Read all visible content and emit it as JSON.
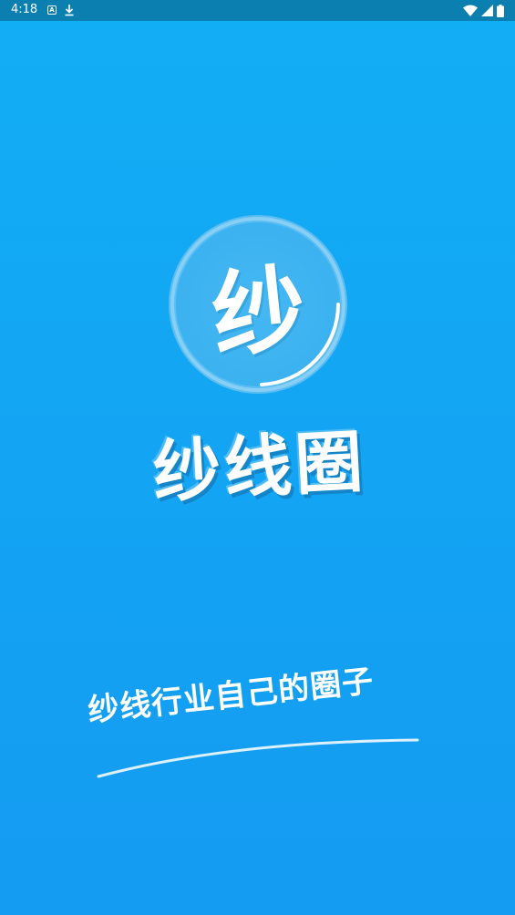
{
  "status_bar": {
    "time": "4:18",
    "icons": [
      "a-notification-icon",
      "download-icon",
      "wifi-icon",
      "signal-icon",
      "battery-icon"
    ]
  },
  "logo": {
    "char": "纱"
  },
  "app_name": "纱线圈",
  "slogan": "纱线行业自己的圈子",
  "colors": {
    "background_top": "#12AEF4",
    "background_bottom": "#149BF2",
    "status_bar": "#0A7FB0",
    "text": "#FFFFFF"
  }
}
